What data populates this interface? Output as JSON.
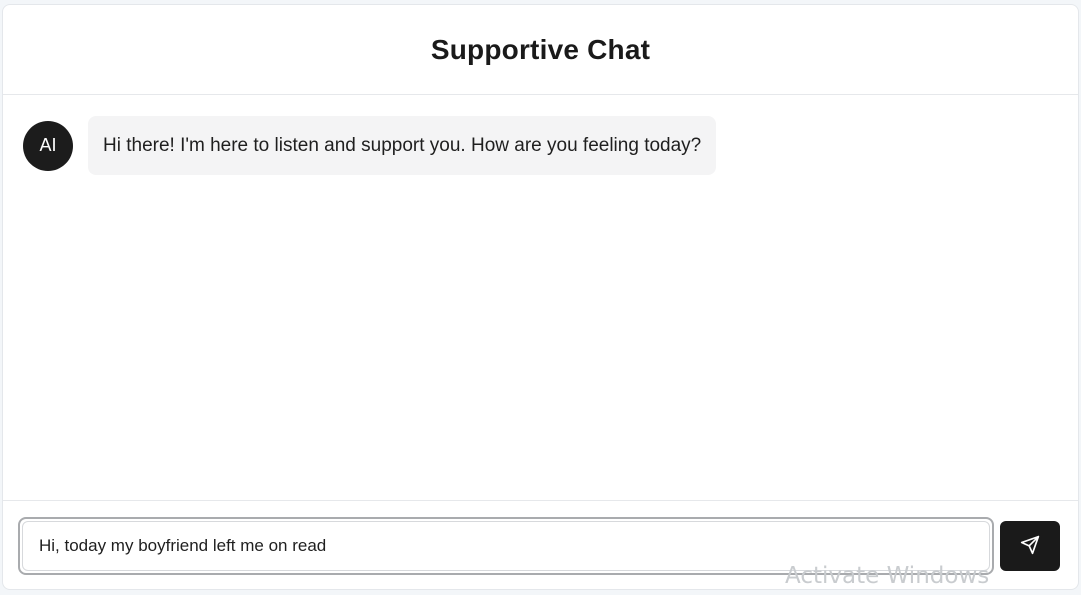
{
  "header": {
    "title": "Supportive Chat"
  },
  "messages": [
    {
      "sender": "assistant",
      "avatar_label": "AI",
      "text": "Hi there! I'm here to listen and support you. How are you feeling today?"
    }
  ],
  "composer": {
    "input_value": "Hi, today my boyfriend left me on read",
    "send_icon": "send-icon"
  },
  "os_overlay": {
    "watermark": "Activate Windows"
  },
  "colors": {
    "avatar_bg": "#1c1c1c",
    "bubble_bg": "#f4f4f5",
    "send_button_bg": "#1a1a1a"
  }
}
